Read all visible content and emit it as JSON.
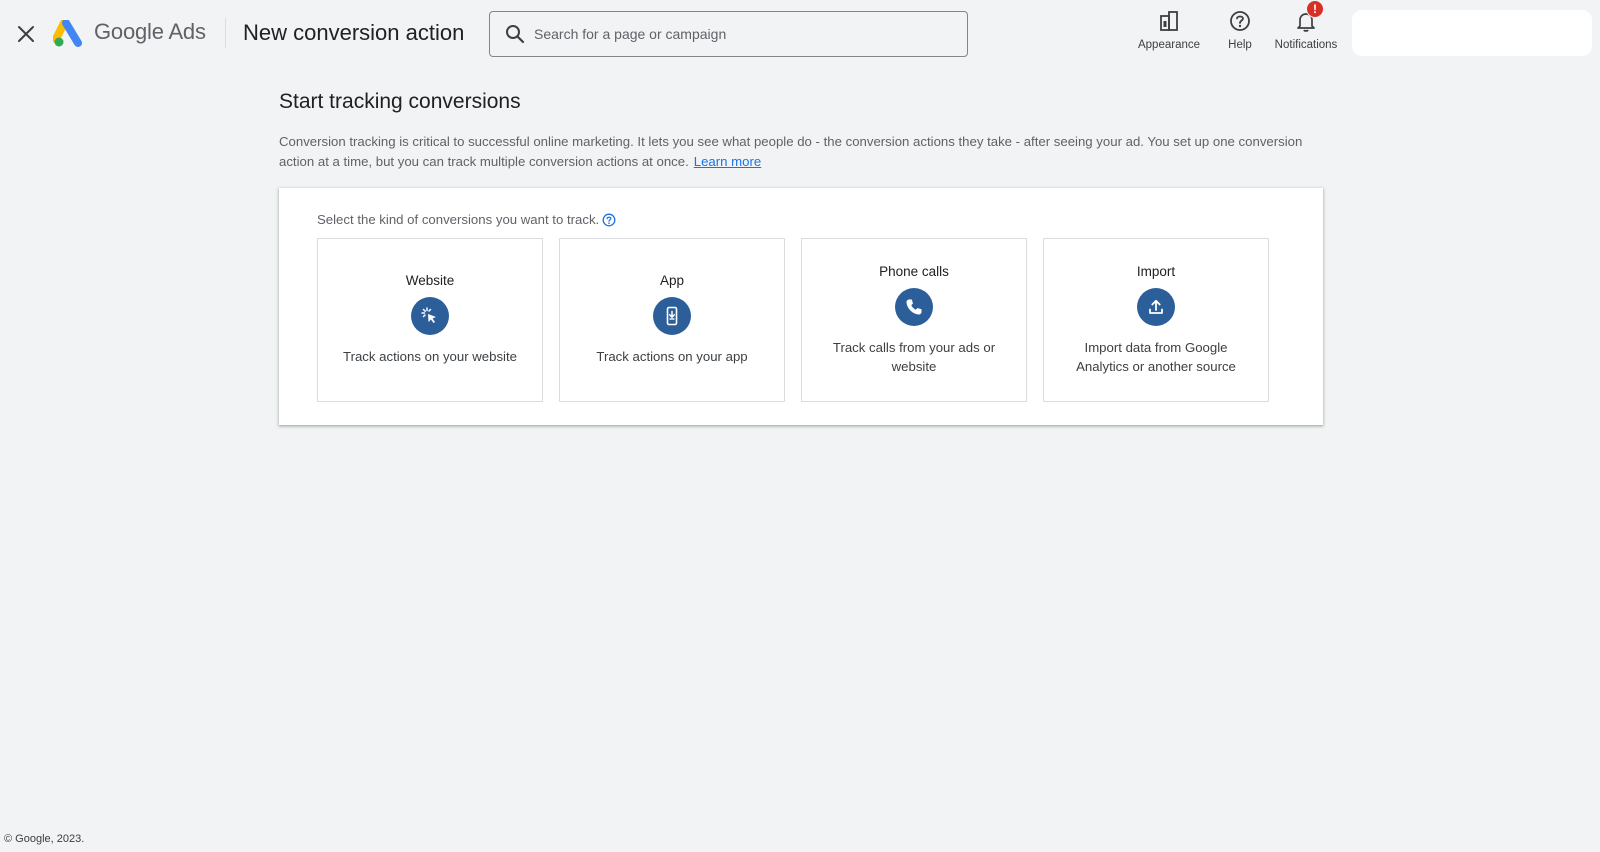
{
  "header": {
    "close_label": "Close",
    "brand": "Google Ads",
    "title": "New conversion action",
    "search_placeholder": "Search for a page or campaign",
    "actions": {
      "appearance": "Appearance",
      "help": "Help",
      "notifications": "Notifications",
      "notifications_badge": "!"
    }
  },
  "main": {
    "heading": "Start tracking conversions",
    "description": "Conversion tracking is critical to successful online marketing. It lets you see what people do - the conversion actions they take - after seeing your ad. You set up one conversion action at a time, but you can track multiple conversion actions at once.",
    "learn_more": "Learn more",
    "prompt": "Select the kind of conversions you want to track.",
    "options": [
      {
        "title": "Website",
        "description": "Track actions on your website",
        "icon": "cursor-click-icon"
      },
      {
        "title": "App",
        "description": "Track actions on your app",
        "icon": "phone-download-icon"
      },
      {
        "title": "Phone calls",
        "description": "Track calls from your ads or website",
        "icon": "phone-call-icon"
      },
      {
        "title": "Import",
        "description": "Import data from Google Analytics or another source",
        "icon": "upload-icon"
      }
    ]
  },
  "footer": {
    "copyright": "© Google, 2023."
  },
  "colors": {
    "accent": "#2c5f9a",
    "link": "#1a73e8",
    "badge": "#d93025",
    "background": "#f1f3f4"
  }
}
